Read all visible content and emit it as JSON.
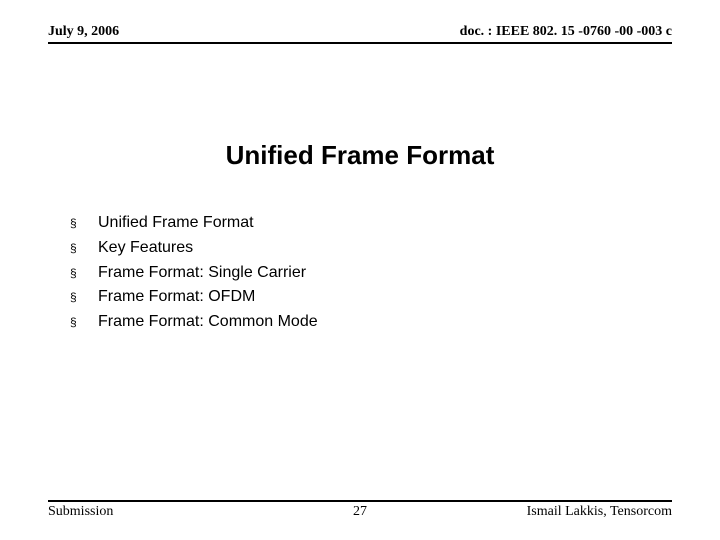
{
  "header": {
    "date": "July 9, 2006",
    "docref": "doc. : IEEE 802. 15 -0760 -00 -003 c"
  },
  "title": "Unified Frame Format",
  "bullets": [
    "Unified Frame Format",
    "Key Features",
    "Frame Format: Single Carrier",
    "Frame Format: OFDM",
    "Frame Format: Common Mode"
  ],
  "footer": {
    "left": "Submission",
    "center": "27",
    "right": "Ismail Lakkis, Tensorcom"
  }
}
